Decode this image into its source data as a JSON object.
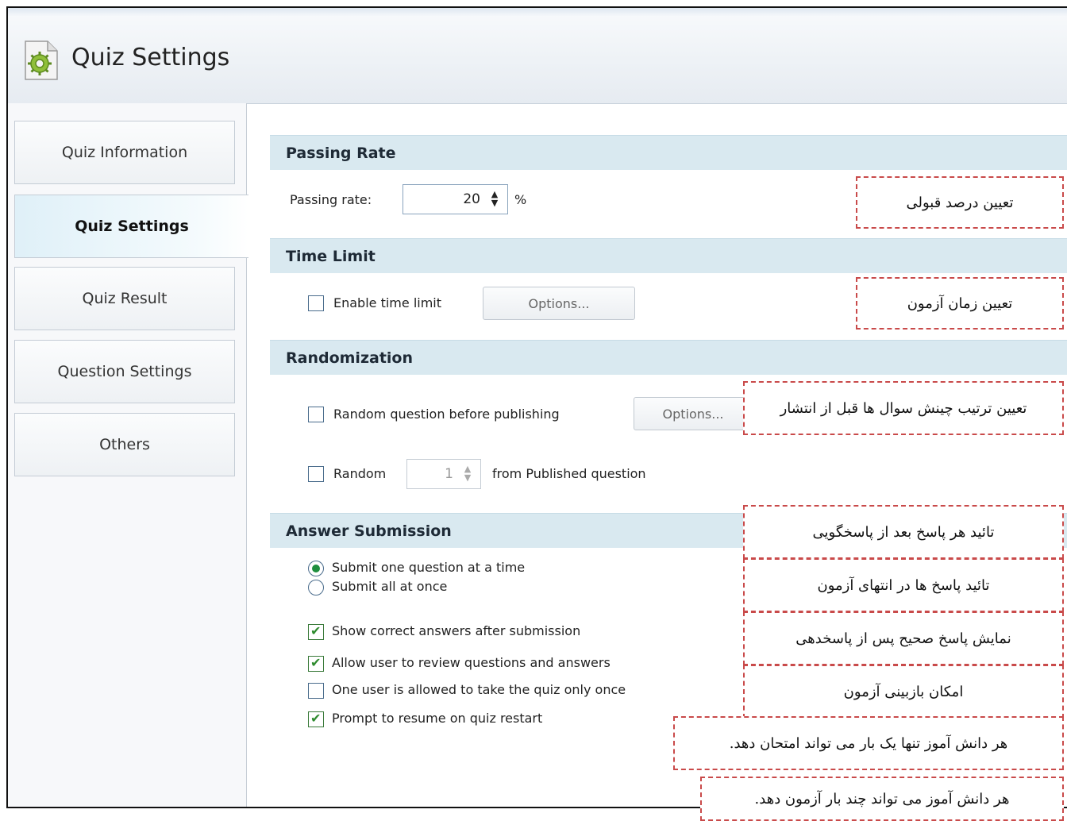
{
  "header": {
    "title": "Quiz Settings",
    "icon": "settings-gear-document-icon"
  },
  "sidebar": {
    "tabs": [
      {
        "label": "Quiz Information"
      },
      {
        "label": "Quiz Settings"
      },
      {
        "label": "Quiz Result"
      },
      {
        "label": "Question Settings"
      },
      {
        "label": "Others"
      }
    ],
    "active_tab": "Quiz Settings"
  },
  "passing_rate": {
    "heading": "Passing  Rate",
    "label": "Passing rate:",
    "value": "20",
    "unit": "%"
  },
  "time_limit": {
    "heading": "Time Limit",
    "enable_label": "Enable time limit",
    "enable_checked": false,
    "options_label": "Options..."
  },
  "randomization": {
    "heading": "Randomization",
    "random_before_publishing_label": "Random question before publishing",
    "random_before_publishing_checked": false,
    "options_label": "Options...",
    "random_label": "Random",
    "random_checked": false,
    "random_count": "1",
    "from_published_label": "from Published question"
  },
  "answer_submission": {
    "heading": "Answer Submission",
    "submit_one_label": "Submit one question at a time",
    "submit_all_label": "Submit all at once",
    "selected": "Submit one question at a time",
    "show_correct_label": "Show correct answers after submission",
    "show_correct_checked": true,
    "allow_review_label": "Allow user to review questions and answers",
    "allow_review_checked": true,
    "one_attempt_label": "One user is allowed to take the quiz only once",
    "one_attempt_checked": false,
    "prompt_resume_label": "Prompt to resume on quiz restart",
    "prompt_resume_checked": true
  },
  "annotations": {
    "passing": "تعیین درصد قبولی",
    "time": "تعیین زمان آزمون",
    "random_order": "تعیین ترتیب چینش سوال ها قبل از انتشار",
    "confirm_each": "تائید هر پاسخ بعد از پاسخگویی",
    "confirm_end": "تائید پاسخ ها در انتهای آزمون",
    "show_correct": "نمایش پاسخ صحیح پس از پاسخدهی",
    "review": "امکان بازبینی آزمون",
    "once": "هر دانش آموز تنها یک بار می تواند امتحان دهد.",
    "multiple": "هر دانش آموز می تواند چند بار آزمون دهد."
  },
  "colors": {
    "section_bg": "#d9e9f0",
    "annotation_border": "#c94a4a",
    "check_green": "#2e8b2e"
  }
}
